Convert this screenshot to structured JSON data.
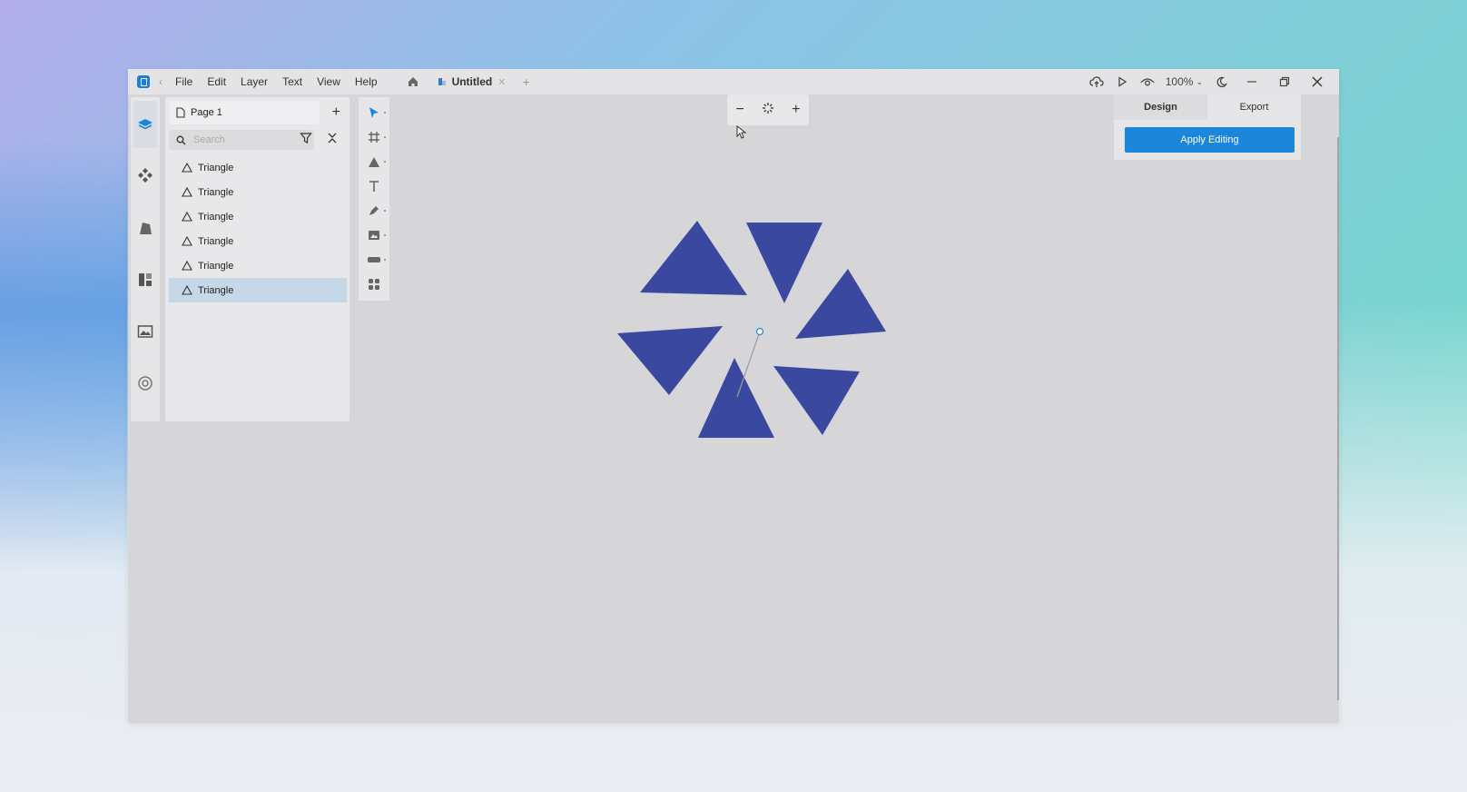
{
  "menu": [
    "File",
    "Edit",
    "Layer",
    "Text",
    "View",
    "Help"
  ],
  "tab": {
    "title": "Untitled"
  },
  "zoom": {
    "label": "100%"
  },
  "pages": {
    "current": "Page 1"
  },
  "search": {
    "placeholder": "Search"
  },
  "layers": [
    {
      "label": "Triangle",
      "selected": false
    },
    {
      "label": "Triangle",
      "selected": false
    },
    {
      "label": "Triangle",
      "selected": false
    },
    {
      "label": "Triangle",
      "selected": false
    },
    {
      "label": "Triangle",
      "selected": false
    },
    {
      "label": "Triangle",
      "selected": true
    }
  ],
  "right_panel": {
    "tabs": [
      "Design",
      "Export"
    ],
    "active_tab": "Design",
    "apply_label": "Apply Editing"
  },
  "colors": {
    "accent": "#1c86da",
    "shape_fill": "#3a48a0",
    "canvas": "#d6d6d8"
  }
}
